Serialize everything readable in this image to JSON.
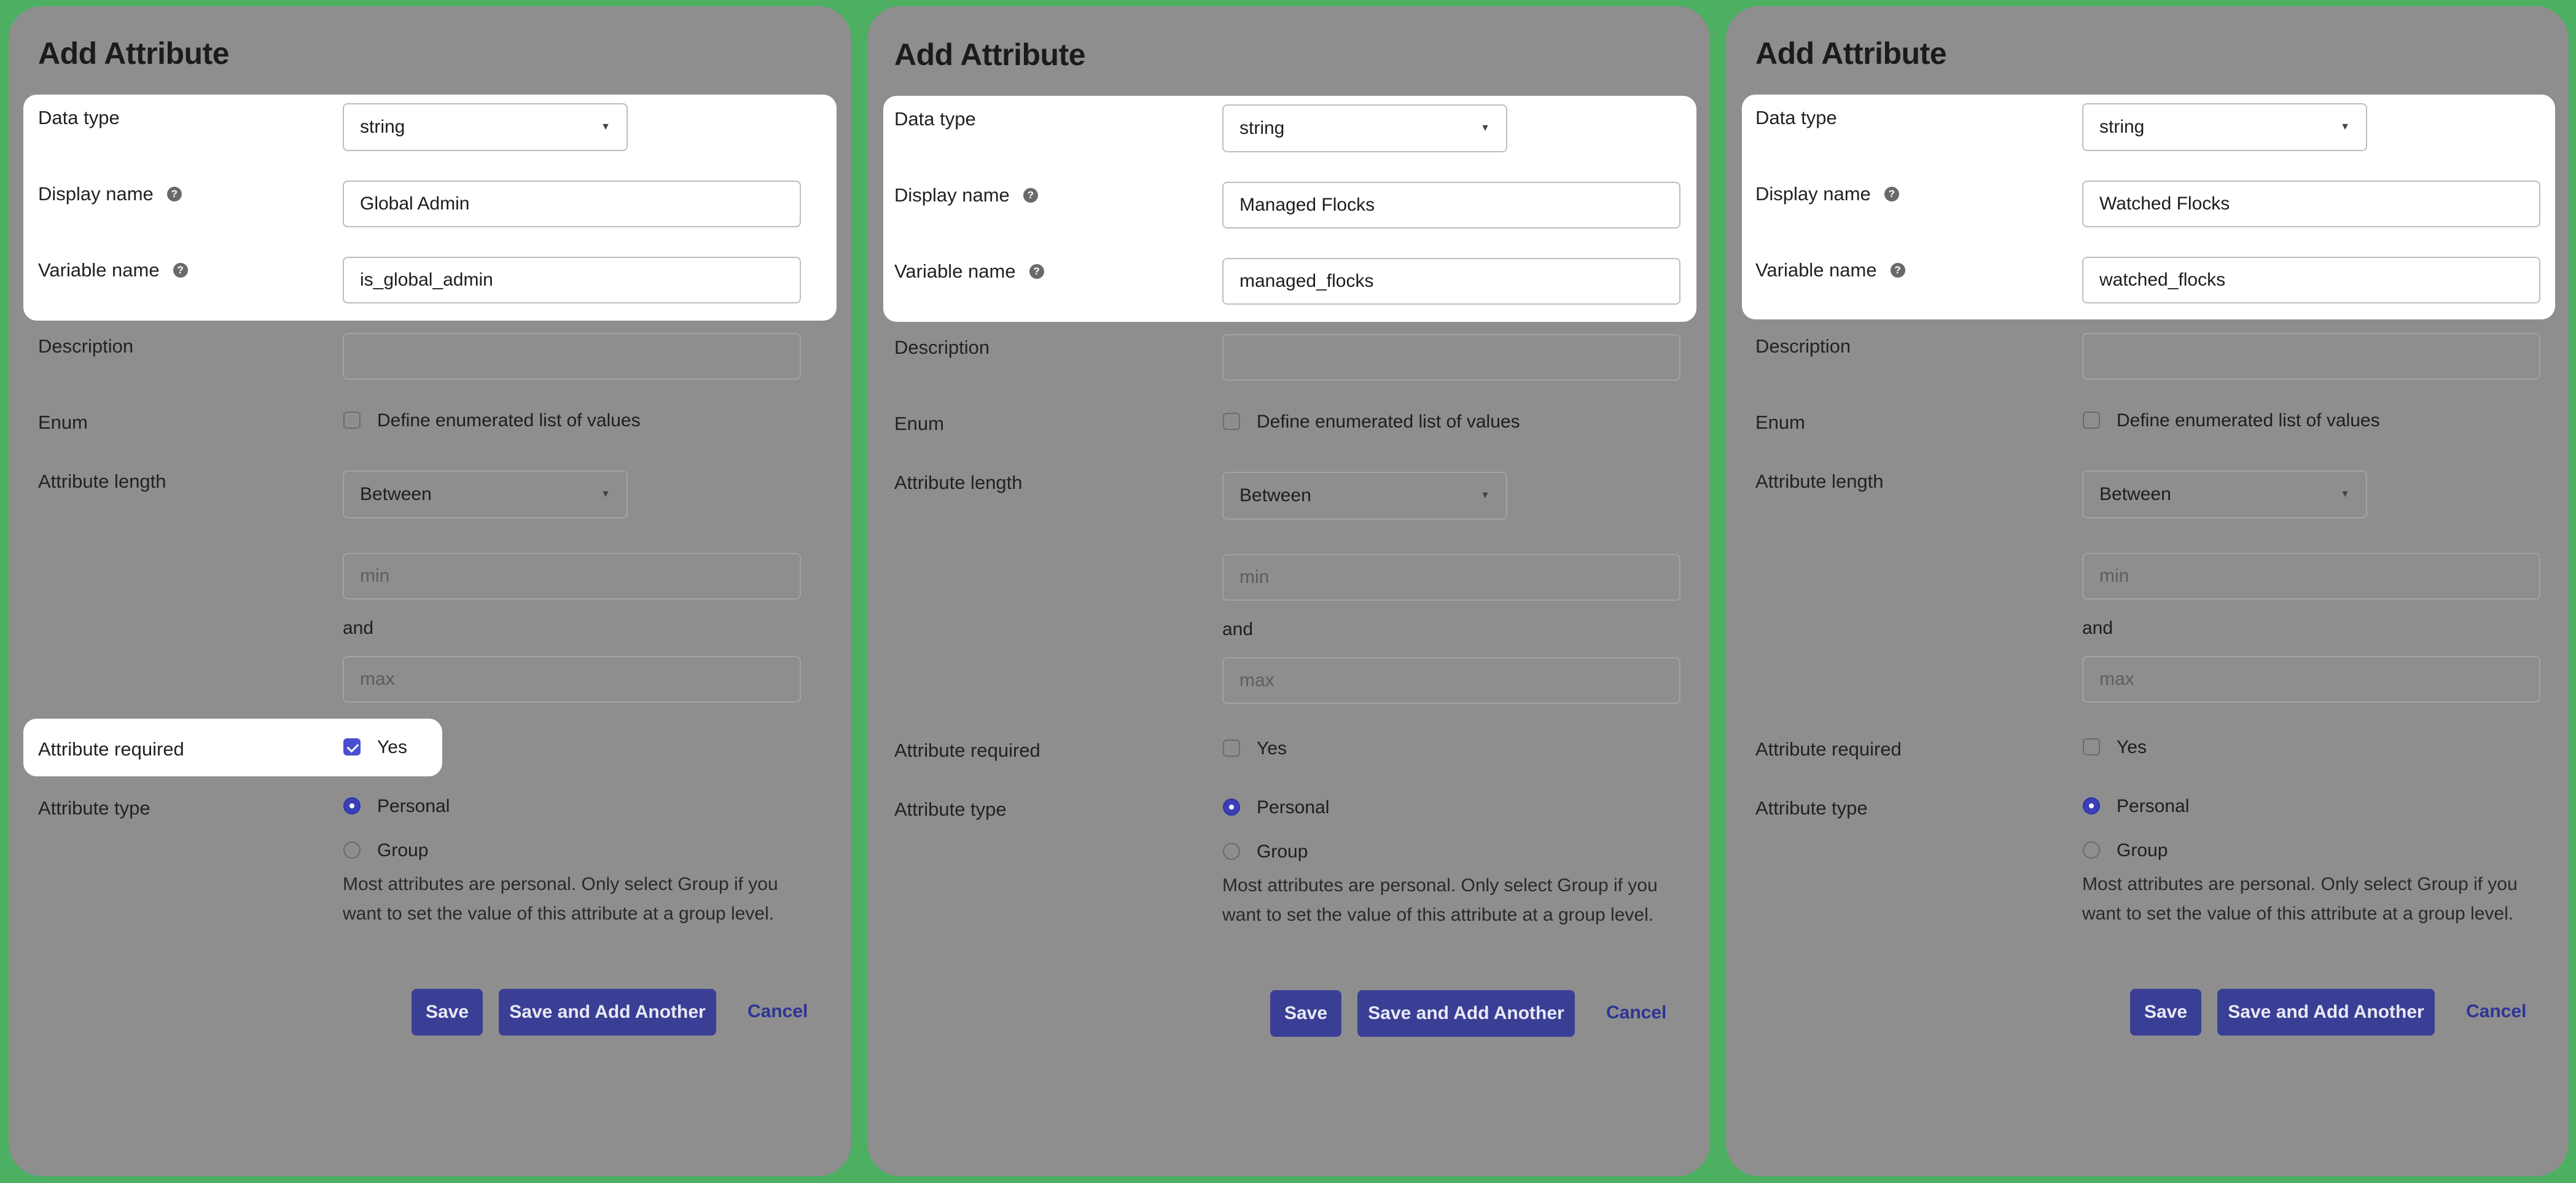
{
  "colors": {
    "background": "#4caf62",
    "panel": "#8e8e8e",
    "primary_button": "#3a3f95",
    "checkbox_checked": "#4a4fd0",
    "radio_selected": "#3b3fb8"
  },
  "panels": [
    {
      "title": "Add Attribute",
      "data_type": {
        "label": "Data type",
        "value": "string"
      },
      "display_name": {
        "label": "Display name",
        "value": "Global Admin",
        "help_icon": "question-circle-icon"
      },
      "variable_name": {
        "label": "Variable name",
        "value": "is_global_admin",
        "help_icon": "question-circle-icon"
      },
      "description": {
        "label": "Description",
        "value": ""
      },
      "enum": {
        "label": "Enum",
        "option_label": "Define enumerated list of values",
        "checked": false
      },
      "attribute_length": {
        "label": "Attribute length",
        "value": "Between",
        "min_placeholder": "min",
        "and_label": "and",
        "max_placeholder": "max"
      },
      "attribute_required": {
        "label": "Attribute required",
        "option_label": "Yes",
        "checked": true
      },
      "attribute_type": {
        "label": "Attribute type",
        "options": [
          "Personal",
          "Group"
        ],
        "selected": "Personal",
        "note": "Most attributes are personal. Only select Group if you want to set the value of this attribute at a group level."
      },
      "buttons": {
        "save": "Save",
        "save_add": "Save and Add Another",
        "cancel": "Cancel"
      }
    },
    {
      "title": "Add Attribute",
      "data_type": {
        "label": "Data type",
        "value": "string"
      },
      "display_name": {
        "label": "Display name",
        "value": "Managed Flocks",
        "help_icon": "question-circle-icon"
      },
      "variable_name": {
        "label": "Variable name",
        "value": "managed_flocks",
        "help_icon": "question-circle-icon"
      },
      "description": {
        "label": "Description",
        "value": ""
      },
      "enum": {
        "label": "Enum",
        "option_label": "Define enumerated list of values",
        "checked": false
      },
      "attribute_length": {
        "label": "Attribute length",
        "value": "Between",
        "min_placeholder": "min",
        "and_label": "and",
        "max_placeholder": "max"
      },
      "attribute_required": {
        "label": "Attribute required",
        "option_label": "Yes",
        "checked": false
      },
      "attribute_type": {
        "label": "Attribute type",
        "options": [
          "Personal",
          "Group"
        ],
        "selected": "Personal",
        "note": "Most attributes are personal. Only select Group if you want to set the value of this attribute at a group level."
      },
      "buttons": {
        "save": "Save",
        "save_add": "Save and Add Another",
        "cancel": "Cancel"
      }
    },
    {
      "title": "Add Attribute",
      "data_type": {
        "label": "Data type",
        "value": "string"
      },
      "display_name": {
        "label": "Display name",
        "value": "Watched Flocks",
        "help_icon": "question-circle-icon"
      },
      "variable_name": {
        "label": "Variable name",
        "value": "watched_flocks",
        "help_icon": "question-circle-icon"
      },
      "description": {
        "label": "Description",
        "value": ""
      },
      "enum": {
        "label": "Enum",
        "option_label": "Define enumerated list of values",
        "checked": false
      },
      "attribute_length": {
        "label": "Attribute length",
        "value": "Between",
        "min_placeholder": "min",
        "and_label": "and",
        "max_placeholder": "max"
      },
      "attribute_required": {
        "label": "Attribute required",
        "option_label": "Yes",
        "checked": false
      },
      "attribute_type": {
        "label": "Attribute type",
        "options": [
          "Personal",
          "Group"
        ],
        "selected": "Personal",
        "note": "Most attributes are personal. Only select Group if you want to set the value of this attribute at a group level."
      },
      "buttons": {
        "save": "Save",
        "save_add": "Save and Add Another",
        "cancel": "Cancel"
      }
    }
  ]
}
